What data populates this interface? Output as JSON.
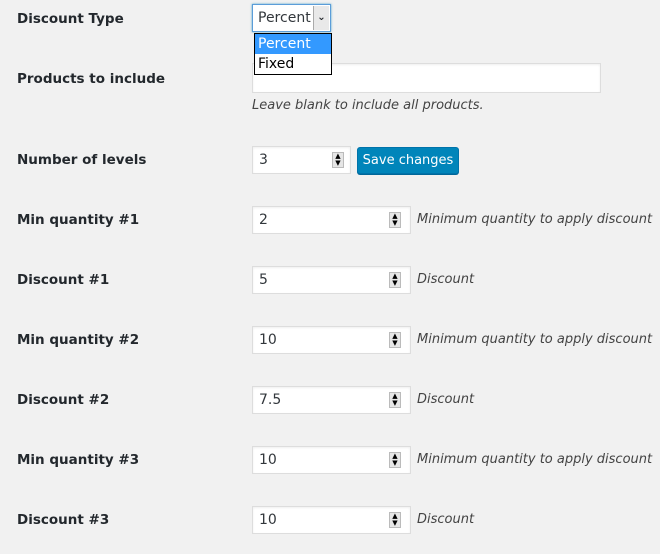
{
  "discount_type": {
    "label": "Discount Type",
    "selected": "Percent",
    "options": [
      "Percent",
      "Fixed"
    ],
    "highlighted": "Percent"
  },
  "products": {
    "label": "Products to include",
    "value": "",
    "description": "Leave blank to include all products."
  },
  "levels": {
    "label": "Number of levels",
    "value": "3",
    "save_label": "Save changes"
  },
  "rows": [
    {
      "label": "Min quantity #1",
      "value": "2",
      "description": "Minimum quantity to apply discount"
    },
    {
      "label": "Discount #1",
      "value": "5",
      "description": "Discount"
    },
    {
      "label": "Min quantity #2",
      "value": "10",
      "description": "Minimum quantity to apply discount"
    },
    {
      "label": "Discount #2",
      "value": "7.5",
      "description": "Discount"
    },
    {
      "label": "Min quantity #3",
      "value": "10",
      "description": "Minimum quantity to apply discount"
    },
    {
      "label": "Discount #3",
      "value": "10",
      "description": "Discount"
    }
  ]
}
